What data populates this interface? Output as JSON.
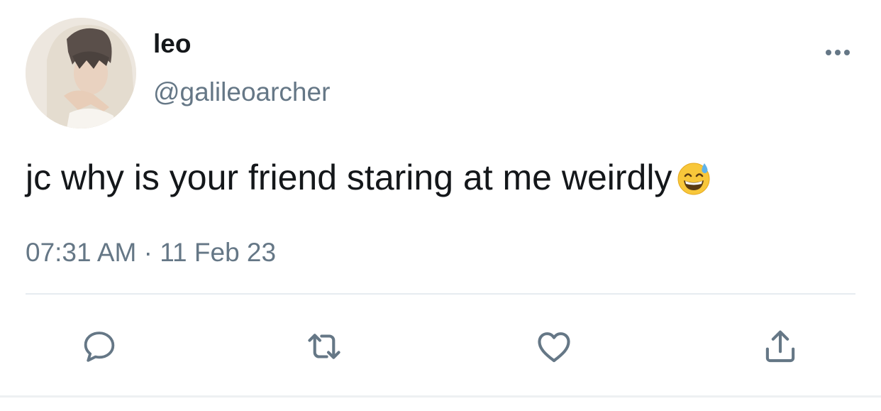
{
  "author": {
    "display_name": "leo",
    "handle": "@galileoarcher"
  },
  "tweet": {
    "text": "jc why is your friend staring at me weirdly",
    "emoji": "grinning-face-with-sweat",
    "timestamp": "07:31 AM · 11 Feb 23"
  },
  "icons": {
    "more": "more-horizontal-icon",
    "reply": "reply-icon",
    "retweet": "retweet-icon",
    "like": "heart-icon",
    "share": "share-icon"
  },
  "colors": {
    "primary_text": "#14171a",
    "secondary_text": "#657786",
    "divider": "#e6ecf0"
  }
}
